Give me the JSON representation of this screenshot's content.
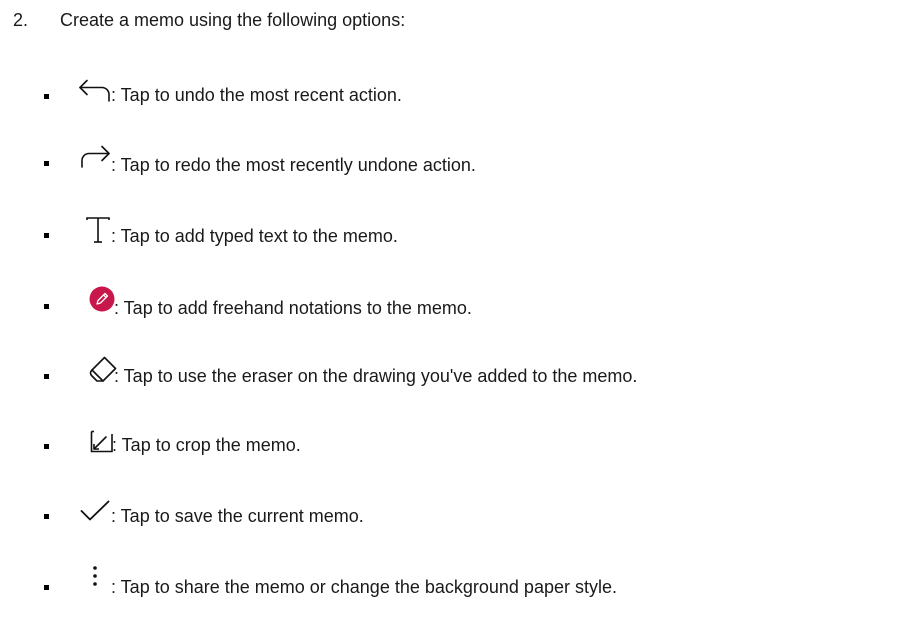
{
  "step": {
    "number": "2.",
    "heading": "Create a memo using the following options:"
  },
  "options": [
    {
      "icon": "undo-icon",
      "text": ": Tap to undo the most recent action."
    },
    {
      "icon": "redo-icon",
      "text": ": Tap to redo the most recently undone action."
    },
    {
      "icon": "text-icon",
      "text": ": Tap to add typed text to the memo."
    },
    {
      "icon": "pen-icon",
      "text": ": Tap to add freehand notations to the memo.",
      "color": "#c8174a"
    },
    {
      "icon": "eraser-icon",
      "text": ": Tap to use the eraser on the drawing you've added to the memo."
    },
    {
      "icon": "crop-icon",
      "text": ": Tap to crop the memo."
    },
    {
      "icon": "check-icon",
      "text": ": Tap to save the current memo."
    },
    {
      "icon": "more-options-icon",
      "text": ": Tap to share the memo or change the background paper style."
    }
  ]
}
